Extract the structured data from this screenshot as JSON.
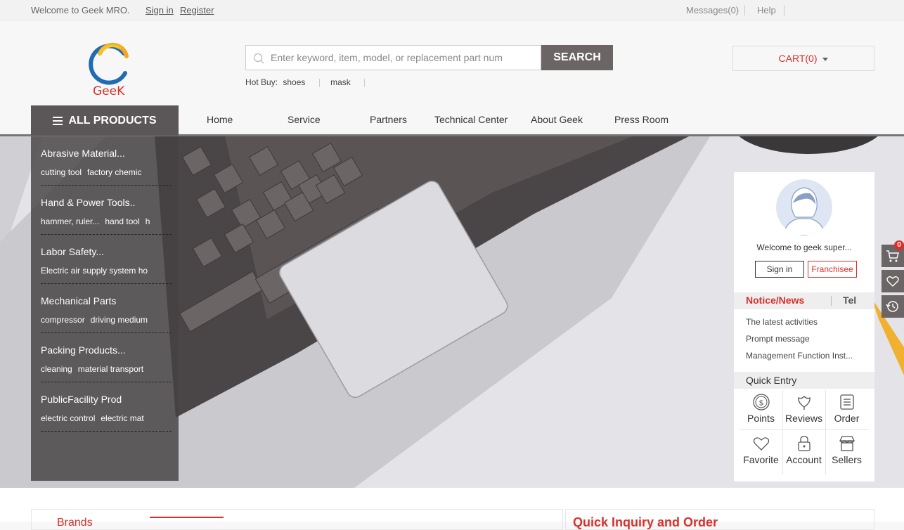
{
  "topbar": {
    "welcome": "Welcome to Geek MRO.",
    "sign_in": "Sign in",
    "register": "Register",
    "messages": "Messages(0)",
    "help": "Help"
  },
  "header": {
    "logo_text": "GeeK",
    "search_placeholder": "Enter keyword, item, model, or replacement part num",
    "search_button": "SEARCH",
    "hot_buy_label": "Hot Buy:",
    "hot_buy_items": [
      "shoes",
      "mask"
    ],
    "cart": "CART(0)"
  },
  "nav": {
    "all_products": "ALL PRODUCTS",
    "items": [
      "Home",
      "Service",
      "Partners",
      "Technical Center",
      "About Geek",
      "Press Room"
    ]
  },
  "categories": [
    {
      "title": "Abrasive Material...",
      "subs": [
        "cutting tool",
        "factory chemic"
      ]
    },
    {
      "title": "Hand & Power Tools..",
      "subs": [
        "hammer, ruler...",
        "hand tool",
        "h"
      ]
    },
    {
      "title": "Labor Safety...",
      "subs": [
        "Electric air supply system ho"
      ]
    },
    {
      "title": "Mechanical Parts",
      "subs": [
        "compressor",
        "driving medium"
      ]
    },
    {
      "title": "Packing Products...",
      "subs": [
        "cleaning",
        "material transport"
      ]
    },
    {
      "title": "PublicFacility Prod",
      "subs": [
        "electric control",
        "electric mat"
      ]
    }
  ],
  "user_panel": {
    "welcome": "Welcome to geek super...",
    "sign_in": "Sign in",
    "franchisee": "Franchisee",
    "tab_notice": "Notice/News",
    "tab_tel": "Tel",
    "notices": [
      "The latest activities",
      "Prompt message",
      "Management Function Inst..."
    ],
    "quick_entry_title": "Quick Entry",
    "quick_entries": [
      {
        "label": "Points",
        "icon": "coin-icon"
      },
      {
        "label": "Reviews",
        "icon": "flower-icon"
      },
      {
        "label": "Order",
        "icon": "order-icon"
      },
      {
        "label": "Favorite",
        "icon": "heart-icon"
      },
      {
        "label": "Account",
        "icon": "lock-icon"
      },
      {
        "label": "Sellers",
        "icon": "store-icon"
      }
    ]
  },
  "right_tools": {
    "cart_count": "0"
  },
  "bottom": {
    "brands": "Brands",
    "quick_inquiry": "Quick Inquiry and Order"
  },
  "colors": {
    "accent": "#d9302b",
    "dark": "#6b6566"
  }
}
